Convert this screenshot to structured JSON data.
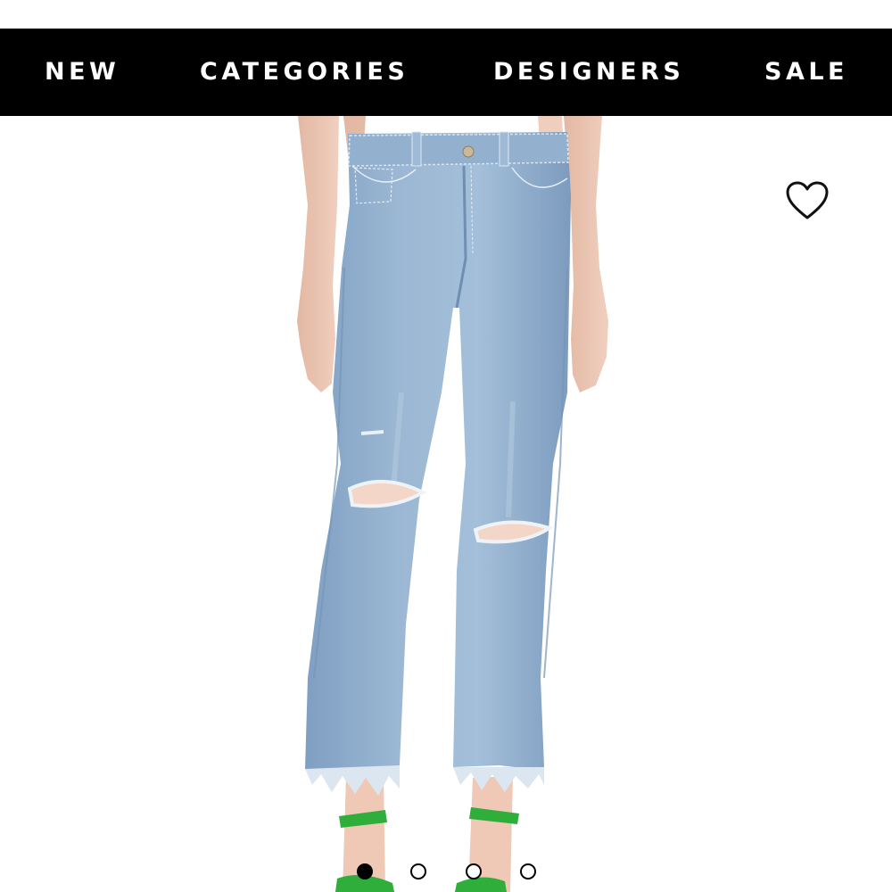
{
  "nav": {
    "items": [
      {
        "label": "NEW"
      },
      {
        "label": "CATEGORIES"
      },
      {
        "label": "DESIGNERS"
      },
      {
        "label": "SALE"
      }
    ]
  },
  "product": {
    "image_subject": "light-wash distressed cropped flare jeans",
    "favorite_icon": "heart-outline-icon"
  },
  "gallery": {
    "image_count": 4,
    "active_index": 1
  },
  "colors": {
    "nav_background": "#000000",
    "nav_text": "#ffffff",
    "denim": "#8fadcc",
    "shoe": "#2fae3c"
  }
}
